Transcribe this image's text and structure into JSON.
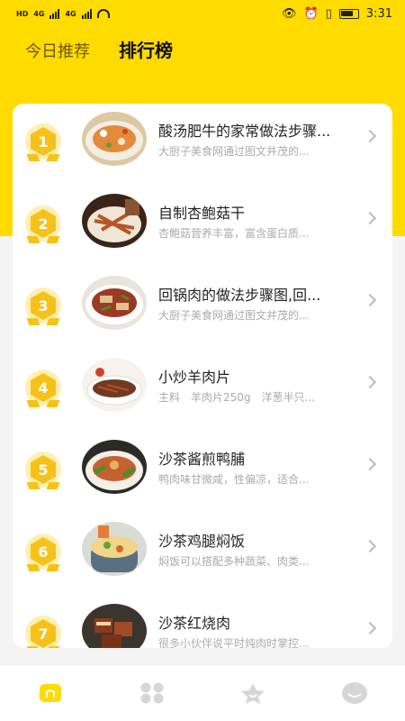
{
  "status_bar": {
    "time": "3:31",
    "network_1": "4G",
    "network_2": "4G",
    "hd": "HD"
  },
  "tabs": [
    {
      "label": "今日推荐",
      "active": false
    },
    {
      "label": "排行榜",
      "active": true
    }
  ],
  "ranking": [
    {
      "rank": "1",
      "title": "酸汤肥牛的家常做法步骤...",
      "desc": "大厨子美食网通过图文并茂的..."
    },
    {
      "rank": "2",
      "title": "自制杏鲍菇干",
      "desc": "杏鲍菇营养丰富，富含蛋白质..."
    },
    {
      "rank": "3",
      "title": "回锅肉的做法步骤图,回...",
      "desc": "大厨子美食网通过图文并茂的..."
    },
    {
      "rank": "4",
      "title": "小炒羊肉片",
      "desc": "主料　羊肉片250g　洋葱半只..."
    },
    {
      "rank": "5",
      "title": "沙茶酱煎鸭脯",
      "desc": "鸭肉味甘微咸，性偏凉，适合..."
    },
    {
      "rank": "6",
      "title": "沙茶鸡腿焖饭",
      "desc": "焖饭可以搭配多种蔬菜、肉类..."
    },
    {
      "rank": "7",
      "title": "沙茶红烧肉",
      "desc": "很多小伙伴说平时炖肉时掌控..."
    }
  ],
  "bottom_nav": [
    {
      "icon": "home-icon",
      "active": true
    },
    {
      "icon": "category-grid-icon",
      "active": false
    },
    {
      "icon": "star-icon",
      "active": false
    },
    {
      "icon": "profile-face-icon",
      "active": false
    }
  ],
  "colors": {
    "accent": "#FFDB00",
    "badge": "#F6C21A",
    "inactive_icon": "#d6d6d6"
  }
}
